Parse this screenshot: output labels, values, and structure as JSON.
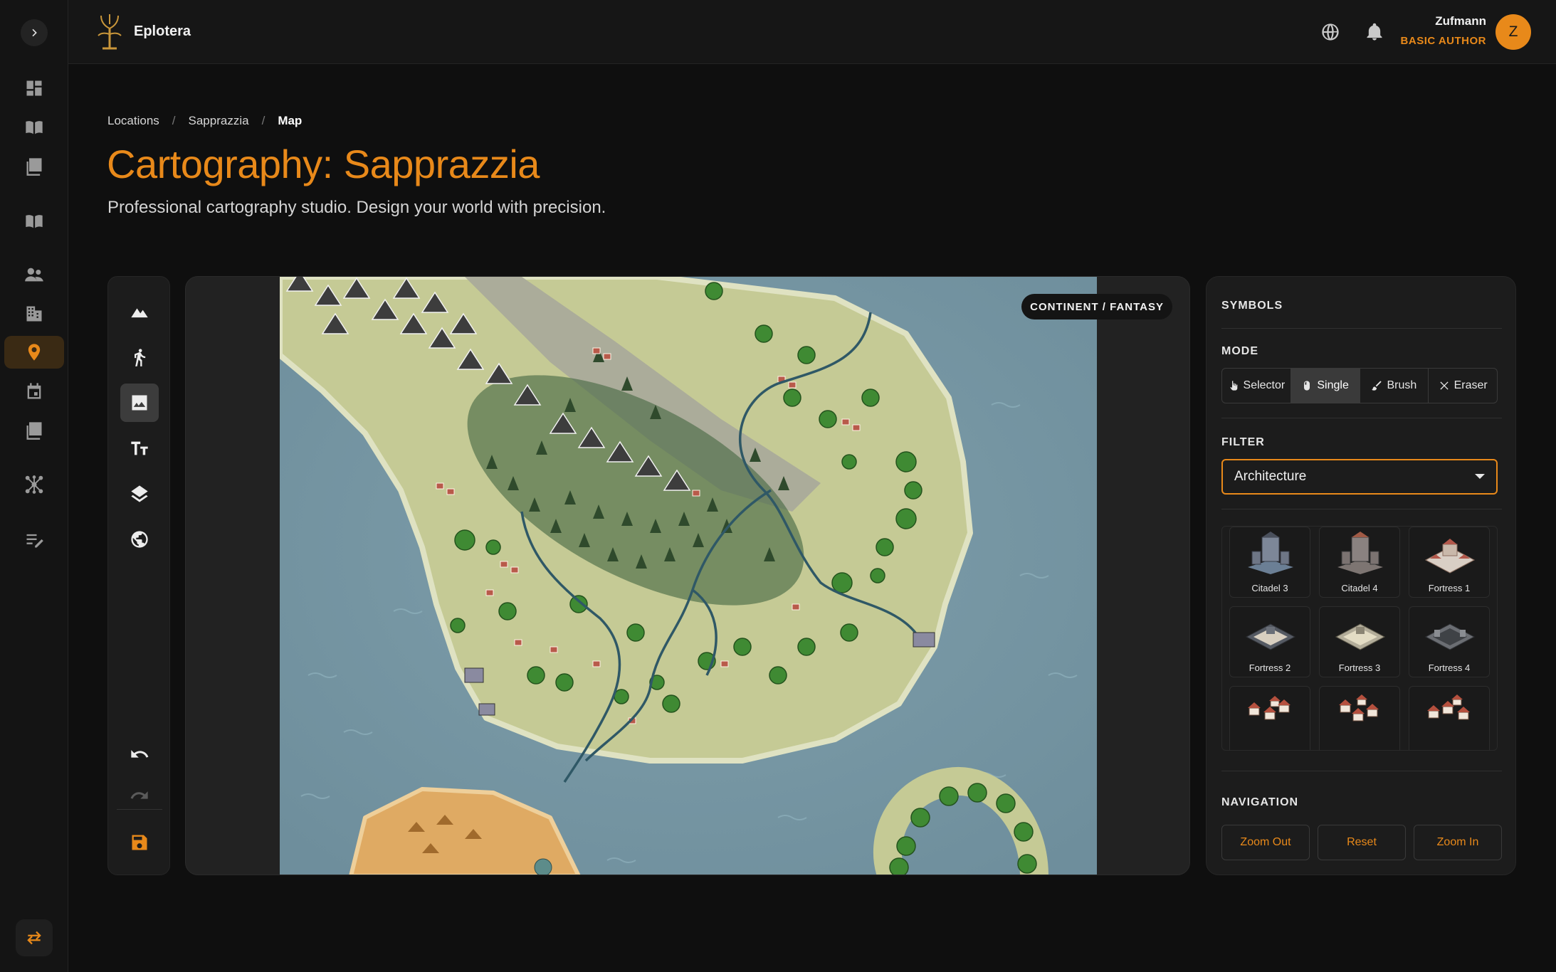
{
  "app": {
    "name": "Eplotera"
  },
  "user": {
    "name": "Zufmann",
    "role": "BASIC AUTHOR",
    "initial": "Z"
  },
  "breadcrumb": [
    "Locations",
    "Sapprazzia",
    "Map"
  ],
  "page": {
    "title": "Cartography: Sapprazzia",
    "subtitle": "Professional cartography studio. Design your world with precision."
  },
  "map": {
    "badge": "CONTINENT / FANTASY"
  },
  "panel": {
    "symbols_heading": "SYMBOLS",
    "mode_heading": "MODE",
    "modes": [
      "Selector",
      "Single",
      "Brush",
      "Eraser"
    ],
    "active_mode": "Single",
    "filter_heading": "FILTER",
    "filter_value": "Architecture",
    "symbols": [
      "Citadel 3",
      "Citadel 4",
      "Fortress 1",
      "Fortress 2",
      "Fortress 3",
      "Fortress 4",
      "",
      "",
      ""
    ],
    "navigation_heading": "NAVIGATION",
    "nav_buttons": [
      "Zoom Out",
      "Reset",
      "Zoom In"
    ]
  },
  "icons": {
    "rail": [
      "dashboard-icon",
      "book-open-icon",
      "library-icon",
      "reader-icon",
      "people-icon",
      "building-icon",
      "location-pin-icon",
      "calendar-icon",
      "notes-icon",
      "network-icon",
      "edit-list-icon"
    ],
    "tools": [
      "mountain-icon",
      "walk-icon",
      "image-icon",
      "text-size-icon",
      "layers-icon",
      "globe-icon",
      "undo-icon",
      "redo-icon",
      "save-icon"
    ]
  },
  "colors": {
    "accent": "#e8891a",
    "background": "#0f0f0f",
    "panel": "#1c1c1c"
  }
}
